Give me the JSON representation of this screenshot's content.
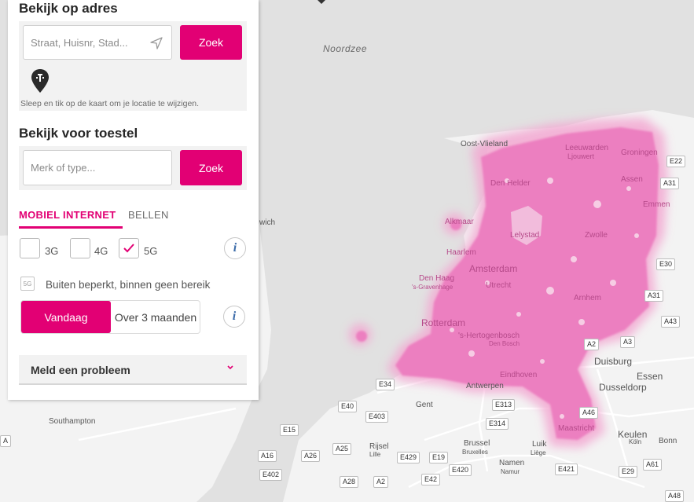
{
  "address_section": {
    "heading": "Bekijk op adres",
    "search_placeholder": "Straat, Huisnr, Stad...",
    "search_button": "Zoek",
    "hint": "Sleep en tik op de kaart om je locatie te wijzigen."
  },
  "device_section": {
    "heading": "Bekijk voor toestel",
    "search_placeholder": "Merk of type...",
    "search_button": "Zoek"
  },
  "tabs": [
    {
      "label": "MOBIEL INTERNET",
      "active": true
    },
    {
      "label": "BELLEN",
      "active": false
    }
  ],
  "network_types": [
    {
      "label": "3G",
      "checked": false
    },
    {
      "label": "4G",
      "checked": false
    },
    {
      "label": "5G",
      "checked": true
    }
  ],
  "legend": {
    "badge": "5G",
    "text": "Buiten beperkt, binnen geen bereik"
  },
  "time_toggle": {
    "options": [
      "Vandaag",
      "Over 3 maanden"
    ],
    "selected": "Vandaag"
  },
  "report": {
    "label": "Meld een probleem"
  },
  "colors": {
    "accent": "#e20074",
    "coverage": "#ec8dc3"
  },
  "map": {
    "sea_label": "Noordzee",
    "places_on_coverage": [
      "Oost-Vlieland",
      "Leeuwarden",
      "Ljouwert",
      "Groningen",
      "Assen",
      "Emmen",
      "Den Helder",
      "Alkmaar",
      "Lelystad",
      "Zwolle",
      "Haarlem",
      "Amsterdam",
      "Den Haag",
      "'s-Gravenhage",
      "Utrecht",
      "Arnhem",
      "Rotterdam",
      "'s-Hertogenbosch",
      "Den Bosch",
      "Eindhoven",
      "Maastricht"
    ],
    "places": [
      "wich",
      "Duisburg",
      "Essen",
      "Dusseldorp",
      "Antwerpen",
      "Gent",
      "Southampton",
      "Brussel",
      "Bruxelles",
      "Rijsel",
      "Lille",
      "Luik",
      "Liège",
      "Namen",
      "Namur",
      "Keulen",
      "Köln",
      "Bonn"
    ],
    "roads": [
      "E22",
      "A31",
      "E30",
      "A31",
      "A43",
      "A3",
      "A2",
      "E34",
      "E40",
      "E403",
      "E313",
      "E314",
      "A46",
      "E15",
      "A16",
      "A26",
      "A25",
      "E429",
      "E19",
      "E42",
      "E420",
      "A28",
      "A2",
      "E402",
      "E421",
      "E29",
      "A61",
      "A48",
      "A"
    ]
  }
}
